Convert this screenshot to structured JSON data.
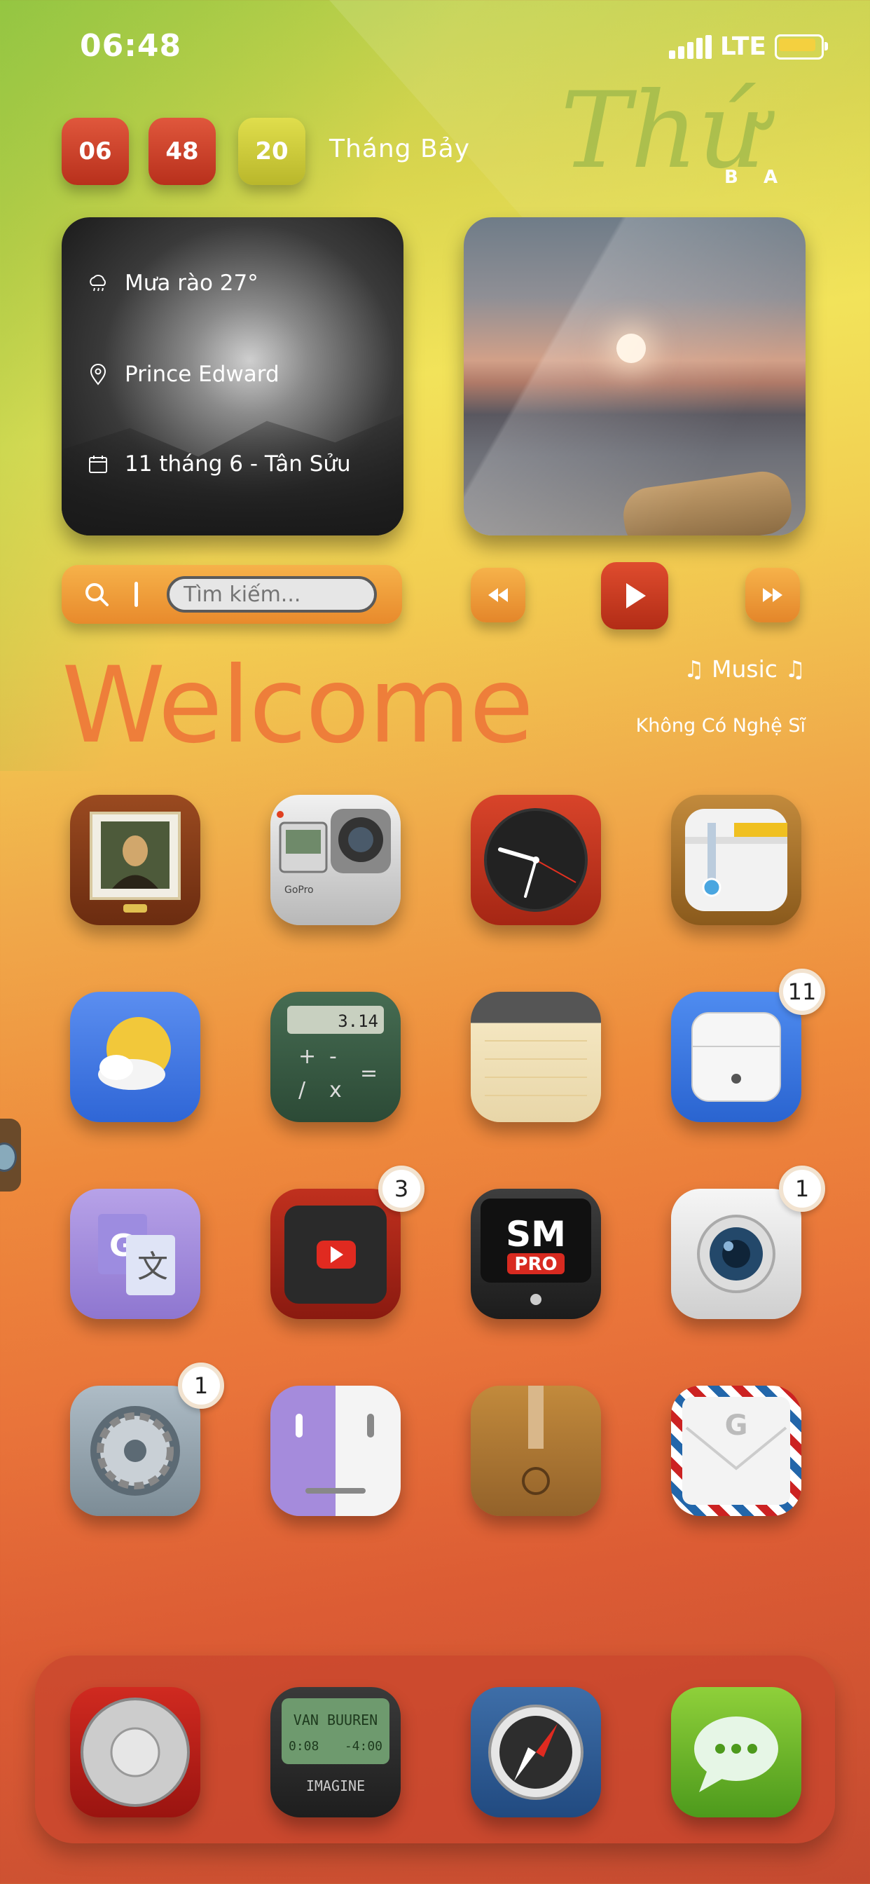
{
  "status_bar": {
    "time": "06:48",
    "network": "LTE"
  },
  "clock_tiles": {
    "hour": "06",
    "minute": "48",
    "second": "20"
  },
  "month_label": "Tháng Bảy",
  "weekday": {
    "script": "Thứ",
    "letter_1": "B",
    "letter_2": "A"
  },
  "weather_widget": {
    "condition": "Mưa rào 27°",
    "location": "Prince Edward",
    "date": "11 tháng 6 - Tân Sửu"
  },
  "search": {
    "placeholder": "Tìm kiếm..."
  },
  "music": {
    "title": "♫ Music ♫",
    "artist": "Không Có Nghệ Sĩ"
  },
  "welcome_text": "Welcome",
  "apps_rows": [
    [
      {
        "name": "photos"
      },
      {
        "name": "gopro"
      },
      {
        "name": "clock"
      },
      {
        "name": "maps"
      }
    ],
    [
      {
        "name": "weather"
      },
      {
        "name": "calculator",
        "display": "3.14"
      },
      {
        "name": "notes"
      },
      {
        "name": "airpods",
        "badge": "11"
      }
    ],
    [
      {
        "name": "translate"
      },
      {
        "name": "youtube",
        "badge": "3"
      },
      {
        "name": "sm-pro",
        "label": "SM",
        "sublabel": "PRO"
      },
      {
        "name": "camera",
        "badge": "1"
      }
    ],
    [
      {
        "name": "settings",
        "badge": "1"
      },
      {
        "name": "toggle-app"
      },
      {
        "name": "cydia-box"
      },
      {
        "name": "gmail"
      }
    ]
  ],
  "dock": [
    {
      "name": "phone"
    },
    {
      "name": "music-player",
      "line1": "VAN BUUREN",
      "line2_left": "0:08",
      "line2_right": "-4:00",
      "line3": "IMAGINE"
    },
    {
      "name": "safari"
    },
    {
      "name": "messages"
    }
  ]
}
